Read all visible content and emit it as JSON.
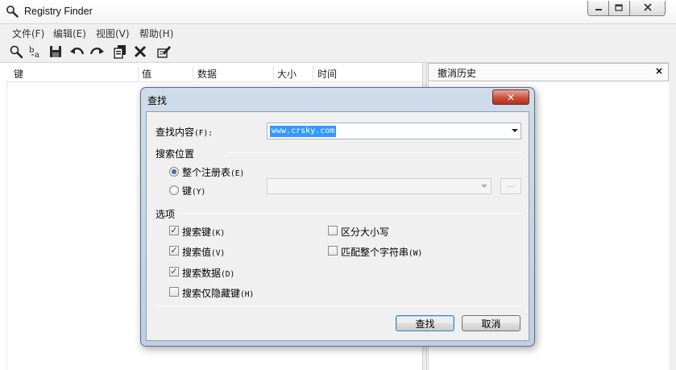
{
  "window": {
    "title": "Registry Finder"
  },
  "menu": [
    {
      "label": "文件(F)"
    },
    {
      "label": "编辑(E)"
    },
    {
      "label": "视图(V)"
    },
    {
      "label": "帮助(H)"
    }
  ],
  "toolbar": {
    "buttons": [
      "search-icon",
      "replace-icon",
      "save-icon",
      "undo-icon",
      "redo-icon",
      "copy-icon",
      "delete-icon",
      "edit-icon"
    ]
  },
  "list": {
    "columns": [
      "键",
      "值",
      "数据",
      "大小",
      "时间"
    ]
  },
  "undo_panel": {
    "title": "撤消历史",
    "close": "×"
  },
  "dialog": {
    "title": "查找",
    "close": "✕",
    "find_label": "查找内容",
    "find_hotkey": "(F):",
    "find_value": "www.crsky.com",
    "location_group": "搜索位置",
    "radio_entire": "整个注册表",
    "radio_entire_hotkey": "(E)",
    "radio_key": "键",
    "radio_key_hotkey": "(Y)",
    "dots": "...",
    "options_group": "选项",
    "chk_search_keys": "搜索键",
    "chk_search_keys_hotkey": "(K)",
    "chk_search_values": "搜索值",
    "chk_search_values_hotkey": "(V)",
    "chk_search_data": "搜索数据",
    "chk_search_data_hotkey": "(D)",
    "chk_hidden_keys": "搜索仅隐藏键",
    "chk_hidden_keys_hotkey": "(H)",
    "chk_case": "区分大小写",
    "chk_whole": "匹配整个字符串",
    "chk_whole_hotkey": "(W)",
    "find_button": "查找",
    "cancel_button": "取消",
    "checked": {
      "search_keys": true,
      "search_values": true,
      "search_data": true,
      "hidden_keys": false,
      "case": false,
      "whole": false
    }
  }
}
